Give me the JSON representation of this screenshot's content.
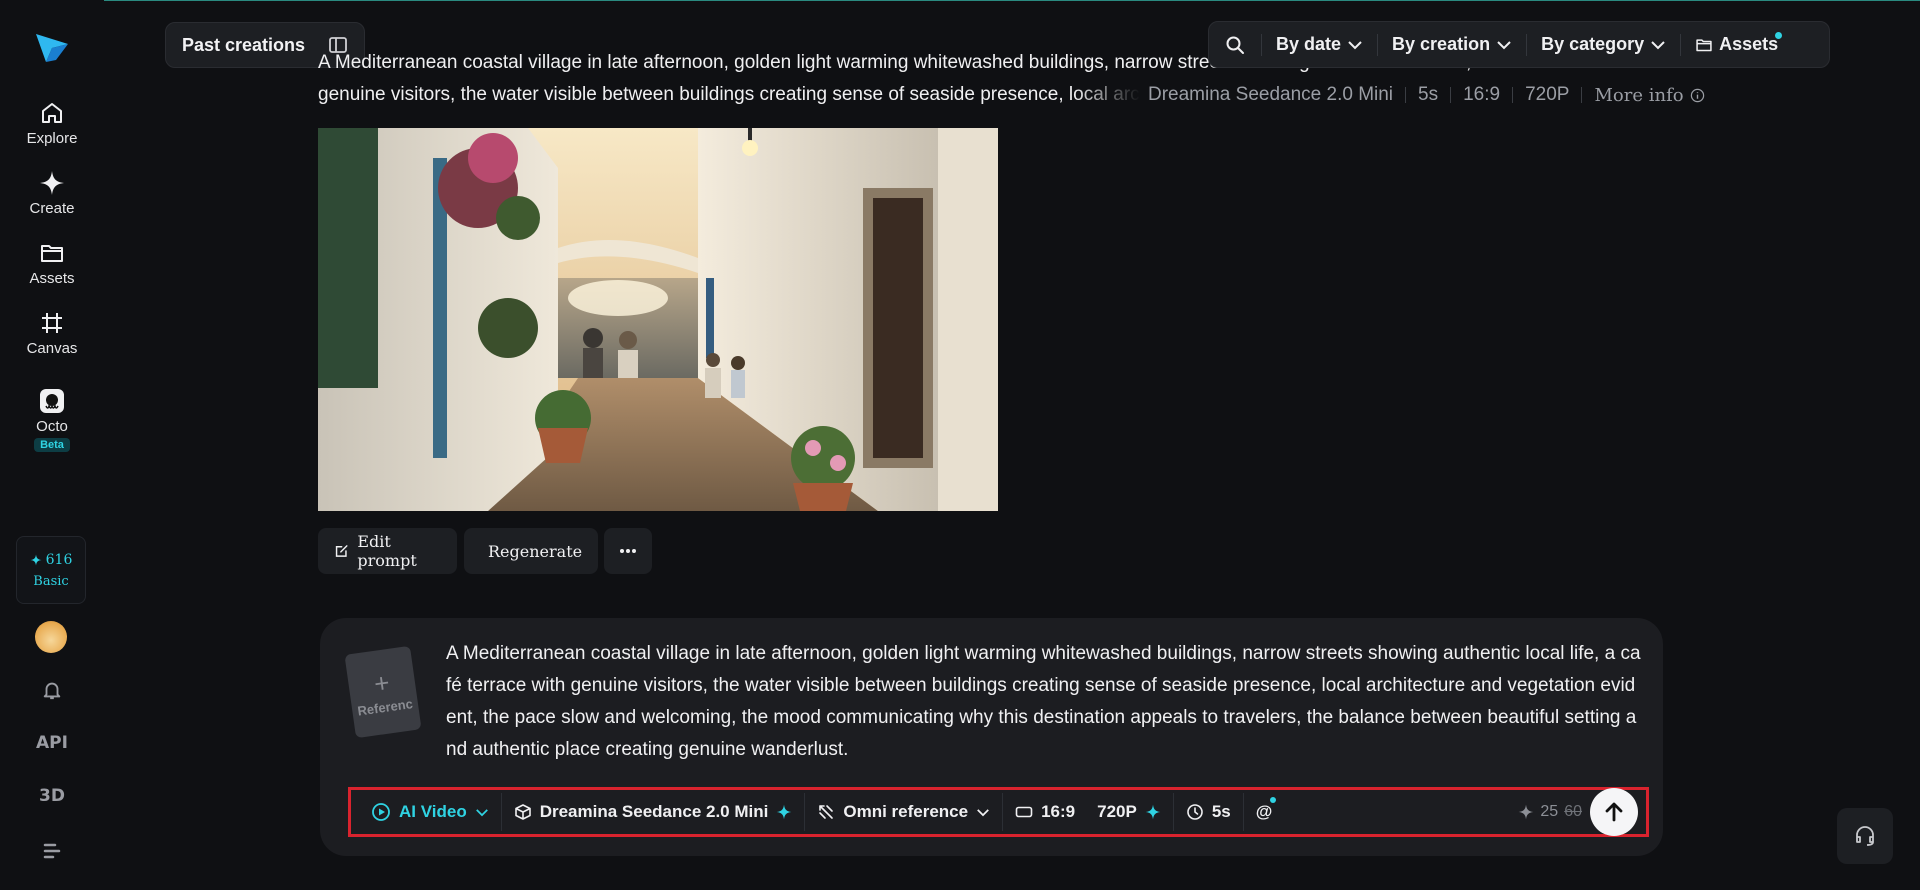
{
  "sidebar": {
    "nav": [
      {
        "label": "Explore",
        "icon": "home-icon"
      },
      {
        "label": "Create",
        "icon": "sparkle-icon"
      },
      {
        "label": "Assets",
        "icon": "folder-icon"
      },
      {
        "label": "Canvas",
        "icon": "canvas-icon"
      },
      {
        "label": "Octo",
        "icon": "octo-icon"
      }
    ],
    "beta_badge": "Beta",
    "credits": {
      "amount": "616",
      "plan": "Basic"
    },
    "api_label": "API",
    "three_d_label": "3D"
  },
  "header": {
    "past_creations": "Past creations",
    "filters": {
      "by_date": "By date",
      "by_creation": "By creation",
      "by_category": "By category",
      "assets": "Assets"
    }
  },
  "creation": {
    "prompt_line1": "A Mediterranean coastal village in late afternoon, golden light warming whitewashed buildings, narrow streets showing authentic local life, a café terrace with",
    "prompt_line2": "genuine visitors, the water visible between buildings creating sense of seaside presence, local architecture and vegetation evident",
    "model": "Dreamina Seedance 2.0 Mini",
    "duration": "5s",
    "ratio": "16:9",
    "resolution": "720P",
    "more_info": "More info",
    "actions": {
      "edit_prompt": "Edit prompt",
      "regenerate": "Regenerate"
    }
  },
  "composer": {
    "reference_label": "Referenc",
    "prompt": "A Mediterranean coastal village in late afternoon, golden light warming whitewashed buildings, narrow streets showing authentic local life, a café terrace with genuine visitors, the water visible between buildings creating sense of seaside presence, local architecture and vegetation evident, the pace slow and welcoming, the mood communicating why this destination appeals to travelers, the balance between beautiful setting and authentic place creating genuine wanderlust.",
    "toolbar": {
      "mode": "AI Video",
      "model": "Dreamina Seedance 2.0 Mini",
      "reference": "Omni reference",
      "ratio": "16:9",
      "resolution": "720P",
      "duration": "5s",
      "mention": "@",
      "cost_current": "25",
      "cost_original": "60"
    }
  },
  "colors": {
    "accent": "#2fd3e3",
    "background": "#0f1013",
    "panel": "#1c1d21",
    "highlight_border": "#d9232e"
  }
}
